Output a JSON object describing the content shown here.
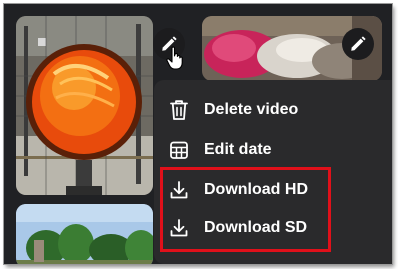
{
  "thumbnails": [
    {
      "id": "thumb-1",
      "subject": "orange-lamp-photo"
    },
    {
      "id": "thumb-2",
      "subject": "pillows-photo"
    },
    {
      "id": "thumb-3",
      "subject": "trees-sky-photo"
    }
  ],
  "menu": {
    "items": [
      {
        "label": "Delete video",
        "icon": "trash-icon"
      },
      {
        "label": "Edit date",
        "icon": "calendar-icon"
      },
      {
        "label": "Download HD",
        "icon": "download-icon"
      },
      {
        "label": "Download SD",
        "icon": "download-icon"
      }
    ]
  },
  "colors": {
    "background": "#202124",
    "menu_background": "#2a2a2c",
    "text": "#ffffff",
    "highlight": "#e0101a"
  }
}
